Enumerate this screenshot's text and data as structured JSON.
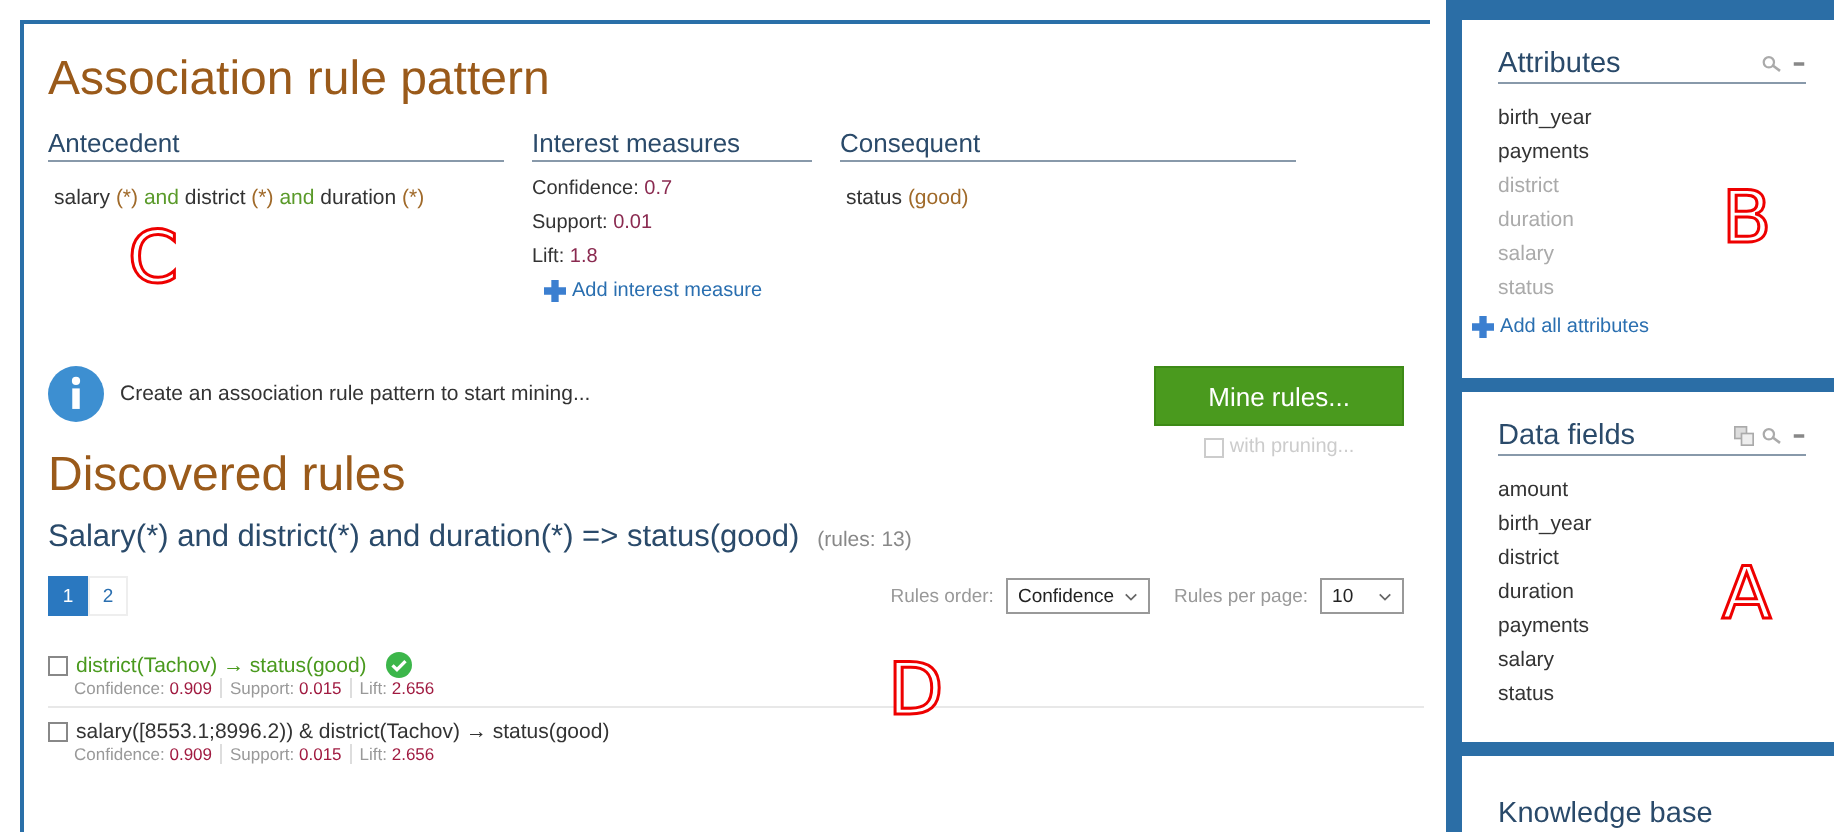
{
  "pattern": {
    "title": "Association rule pattern",
    "antecedent": {
      "heading": "Antecedent",
      "annotation": "C",
      "parts": [
        {
          "kind": "attr",
          "text": "salary"
        },
        {
          "kind": "coef",
          "text": "(*)"
        },
        {
          "kind": "conj",
          "text": "and"
        },
        {
          "kind": "attr",
          "text": "district"
        },
        {
          "kind": "coef",
          "text": "(*)"
        },
        {
          "kind": "conj",
          "text": "and"
        },
        {
          "kind": "attr",
          "text": "duration"
        },
        {
          "kind": "coef",
          "text": "(*)"
        }
      ]
    },
    "measures": {
      "heading": "Interest measures",
      "items": [
        {
          "name": "Confidence:",
          "value": "0.7"
        },
        {
          "name": "Support:",
          "value": "0.01"
        },
        {
          "name": "Lift:",
          "value": "1.8"
        }
      ],
      "add": "Add interest measure"
    },
    "consequent": {
      "heading": "Consequent",
      "parts": [
        {
          "kind": "attr",
          "text": "status"
        },
        {
          "kind": "coef",
          "text": "(good)"
        }
      ]
    },
    "info": "Create an association rule pattern to start mining...",
    "mine_button": "Mine rules...",
    "pruning": {
      "label": "with pruning...",
      "checked": false,
      "disabled": true
    }
  },
  "rules": {
    "title": "Discovered rules",
    "annotation": "D",
    "subtitle": "Salary(*) and district(*) and duration(*) => status(good)",
    "count": "(rules: 13)",
    "pages": [
      {
        "label": "1",
        "selected": true
      },
      {
        "label": "2",
        "selected": false
      }
    ],
    "order_label": "Rules order:",
    "order_value": "Confidence",
    "per_page_label": "Rules per page:",
    "per_page_value": "10",
    "items": [
      {
        "text": "district(Tachov) → status(good)",
        "known": true,
        "checked": false,
        "measures": [
          {
            "name": "Confidence:",
            "value": "0.909"
          },
          {
            "name": "Support:",
            "value": "0.015"
          },
          {
            "name": "Lift:",
            "value": "2.656"
          }
        ]
      },
      {
        "text": "salary([8553.1;8996.2)) & district(Tachov) → status(good)",
        "known": false,
        "checked": false,
        "measures": [
          {
            "name": "Confidence:",
            "value": "0.909"
          },
          {
            "name": "Support:",
            "value": "0.015"
          },
          {
            "name": "Lift:",
            "value": "2.656"
          }
        ]
      }
    ]
  },
  "sidebar": {
    "attributes": {
      "title": "Attributes",
      "annotation": "B",
      "items": [
        {
          "label": "birth_year",
          "used": false
        },
        {
          "label": "payments",
          "used": false
        },
        {
          "label": "district",
          "used": true
        },
        {
          "label": "duration",
          "used": true
        },
        {
          "label": "salary",
          "used": true
        },
        {
          "label": "status",
          "used": true
        }
      ],
      "add": "Add all attributes"
    },
    "data_fields": {
      "title": "Data fields",
      "annotation": "A",
      "items": [
        "amount",
        "birth_year",
        "district",
        "duration",
        "payments",
        "salary",
        "status"
      ]
    },
    "knowledge_base": {
      "title": "Knowledge base"
    }
  }
}
